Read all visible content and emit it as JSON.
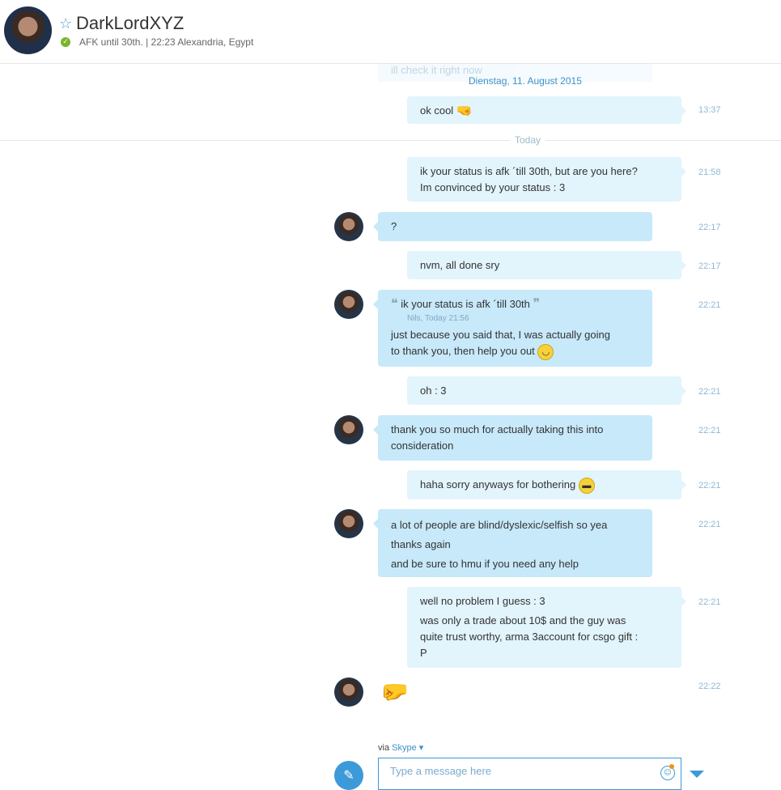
{
  "contact": {
    "name": "DarkLordXYZ",
    "status": "AFK until 30th.",
    "separator": "|",
    "local_time": "22:23 Alexandria, Egypt"
  },
  "faded_message": "ill check it right now",
  "date_divider": "Dienstag, 11. August 2015",
  "today_divider": "Today",
  "messages": [
    {
      "from": "me",
      "time": "13:37",
      "lines": [
        "ok cool"
      ]
    },
    {
      "from": "me",
      "time": "21:58",
      "lines": [
        "ik your status is afk ´till 30th, but are you here?",
        "Im convinced by your status : 3"
      ]
    },
    {
      "from": "them",
      "time": "22:17",
      "lines": [
        "?"
      ]
    },
    {
      "from": "me",
      "time": "22:17",
      "lines": [
        "nvm, all done sry"
      ]
    },
    {
      "from": "them",
      "time": "22:21",
      "quote": "ik your status is afk ´till 30th",
      "quote_meta": "Nils, Today 21:56",
      "lines": [
        "just because you said that, I was actually going",
        "to thank you, then help you out"
      ]
    },
    {
      "from": "me",
      "time": "22:21",
      "lines": [
        "oh : 3"
      ]
    },
    {
      "from": "them",
      "time": "22:21",
      "lines": [
        "thank you so much for actually taking this into",
        "consideration"
      ]
    },
    {
      "from": "me",
      "time": "22:21",
      "lines": [
        "haha sorry anyways for bothering"
      ]
    },
    {
      "from": "them",
      "time": "22:21",
      "lines": [
        "a lot of people are blind/dyslexic/selfish so yea",
        "thanks again",
        "and be sure to hmu if you need any help"
      ]
    },
    {
      "from": "me",
      "time": "22:21",
      "lines": [
        "well no problem I guess : 3",
        "was only a trade about 10$ and the guy was",
        "quite trust worthy, arma 3account for csgo gift :",
        "P"
      ]
    },
    {
      "from": "them",
      "time": "22:22",
      "lines": []
    }
  ],
  "composer": {
    "via_label": "via",
    "via_service": "Skype",
    "placeholder": "Type a message here"
  },
  "icons": [
    "star-icon",
    "status-online-icon",
    "fist-bump-emoji",
    "smile-emoji",
    "grin-emoji",
    "attach-icon",
    "emoticon-icon",
    "send-menu-icon"
  ],
  "colors": {
    "accent": "#3d9ad8",
    "bubble_me": "#e2f4fc",
    "bubble_them": "#c7e9fa",
    "online": "#7bb52b"
  }
}
